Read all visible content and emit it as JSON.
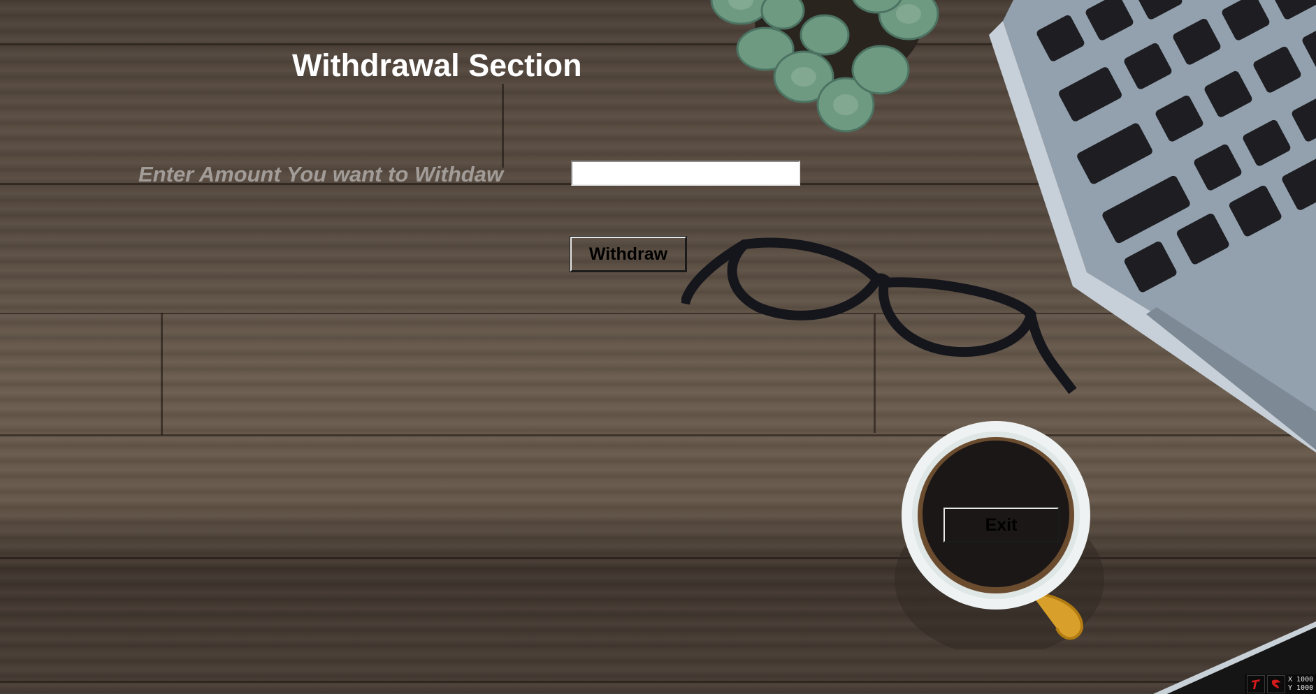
{
  "title": "Withdrawal Section",
  "form": {
    "amount_label": "Enter Amount You want to Withdaw",
    "amount_value": "",
    "withdraw_label": "Withdraw",
    "exit_label": "Exit"
  },
  "tray": {
    "x_readout": "X 1000",
    "y_readout": "Y 1000"
  },
  "colors": {
    "title": "#ffffff",
    "label": "#a29c98",
    "button_text": "#000000",
    "input_bg": "#ffffff"
  },
  "background_icons": [
    "succulent-plant-icon",
    "laptop-icon",
    "glasses-icon",
    "coffee-cup-icon"
  ]
}
